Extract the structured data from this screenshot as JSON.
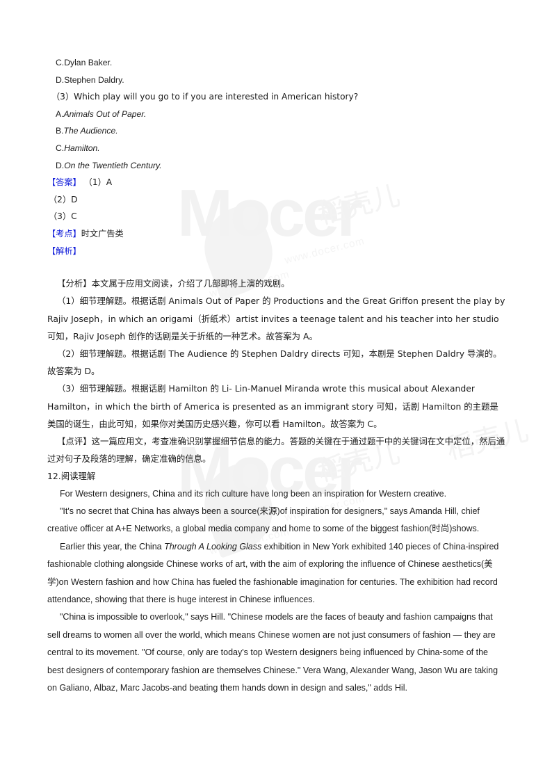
{
  "document": {
    "type": "exam-answer-sheet",
    "watermark": {
      "brand_cn": "稻壳儿",
      "brand_en": "Mocer",
      "url": "www.docer.com"
    },
    "colors": {
      "heading_blue": "#0a16d8",
      "body_text": "#1a1a1a",
      "page_background": "#ffffff",
      "watermark_gray": "#f2f2f2"
    }
  },
  "question_options_top": [
    {
      "label": "C.Dylan Baker."
    },
    {
      "label": "D.Stephen Daldry."
    }
  ],
  "question_3": {
    "stem": "（3）Which play will you go to if you are interested in American history?",
    "options": [
      {
        "prefix": "A.",
        "title": "Animals Out of Paper.",
        "italic": true
      },
      {
        "prefix": "B.",
        "title": "The Audience.",
        "italic": true
      },
      {
        "prefix": "C.",
        "title": "Hamilton.",
        "italic": true
      },
      {
        "prefix": "D.",
        "title": "On the Twentieth Century.",
        "italic": true
      }
    ]
  },
  "answer_block": {
    "label": "【答案】",
    "first_answer": "（1）A",
    "other_answers": [
      "（2）D",
      "（3）C"
    ]
  },
  "knowledge_point": {
    "label": "【考点】",
    "value": "时文广告类"
  },
  "explanation": {
    "label": "【解析】"
  },
  "analysis": {
    "label": "【分析】",
    "intro": "本文属于应用文阅读，介绍了几部即将上演的戏剧。",
    "items": [
      "（1）细节理解题。根据话剧 Animals Out of Paper 的 Productions and the Great Griffon present the play by Rajiv Joseph，in which an origami（折纸术）artist invites a teenage talent and his teacher into her studio 可知，Rajiv Joseph 创作的话剧是关于折纸的一种艺术。故答案为 A。",
      "（2）细节理解题。根据话剧 The Audience 的 Stephen Daldry directs 可知，本剧是 Stephen Daldry 导演的。故答案为 D。",
      "（3）细节理解题。根据话剧 Hamilton 的 Li- Lin-Manuel Miranda wrote this musical about Alexander Hamilton，in which the birth of America is presented as an immigrant story 可知，话剧 Hamilton 的主题是美国的诞生，由此可知，如果你对美国历史感兴趣，你可以看 Hamilton。故答案为 C。"
    ]
  },
  "comment": {
    "label": "【点评】",
    "text": "这一篇应用文，考查准确识别掌握细节信息的能力。答题的关键在于通过题干中的关键词在文中定位，然后通过对句子及段落的理解，确定准确的信息。"
  },
  "next_question": {
    "number": "12.",
    "title": "阅读理解",
    "passage_paragraphs": [
      {
        "id": "p1",
        "text": "For Western designers, China and its rich culture have long been an inspiration for Western creative."
      },
      {
        "id": "p2",
        "text": "\"It's no secret that China has always been a source(来源)of inspiration for designers,\" says Amanda Hill, chief creative officer at A+E Networks, a global media company and home to some of the biggest fashion(时尚)shows."
      },
      {
        "id": "p3",
        "lead": "Earlier this year, the China ",
        "italic_title": "Through A Looking Glass",
        "tail": " exhibition in New York exhibited 140 pieces of China-inspired fashionable clothing alongside Chinese works of art, with the aim of exploring the influence of Chinese aesthetics(美学)on Western fashion and how China has fueled the fashionable imagination for centuries. The exhibition had record attendance, showing that there is huge interest in Chinese influences."
      },
      {
        "id": "p4",
        "text": "\"China is impossible to overlook,\" says Hill. \"Chinese models are the faces of beauty and fashion campaigns that sell dreams to women all over the world, which means Chinese women are not just consumers of fashion — they are central to its movement. \"Of course, only are today's top Western designers being influenced by China-some of the best designers of contemporary fashion are themselves Chinese.\" Vera Wang, Alexander Wang, Jason Wu are taking on Galiano, Albaz, Marc Jacobs-and beating them hands down in design and sales,\" adds Hil."
      }
    ]
  }
}
